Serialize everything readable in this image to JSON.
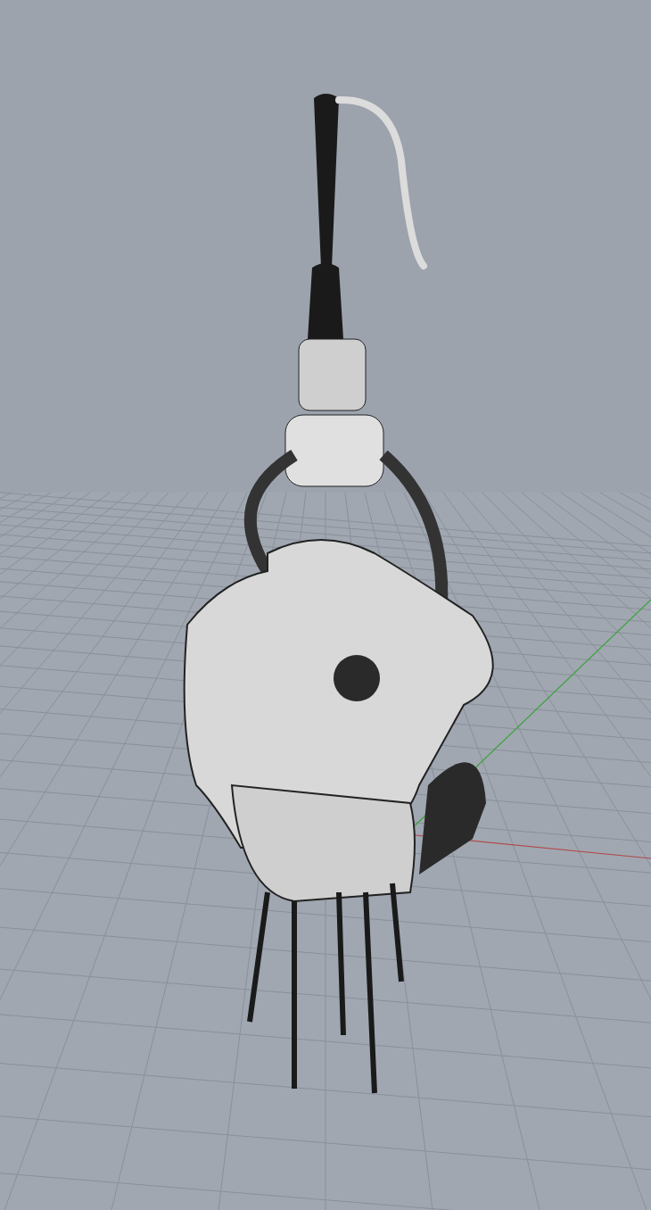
{
  "viewport": {
    "show_grid": true,
    "show_axes": true
  }
}
